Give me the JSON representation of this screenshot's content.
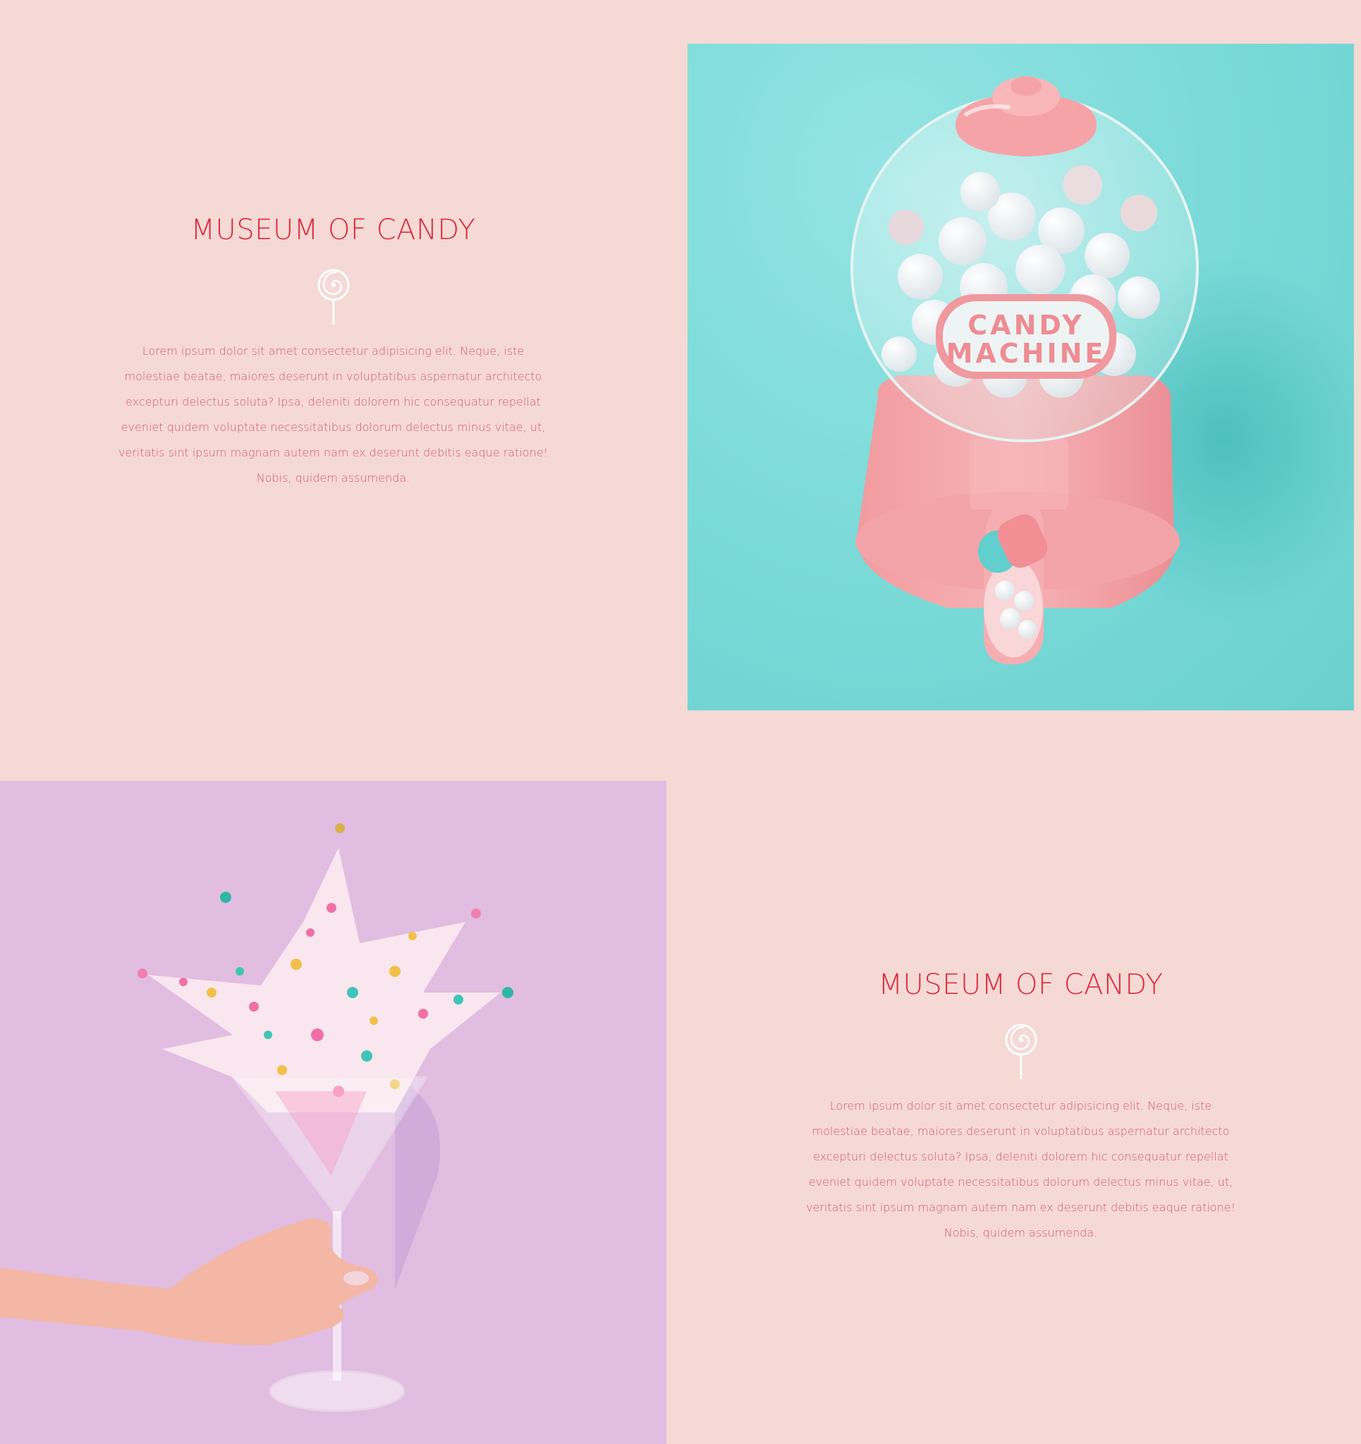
{
  "sections": [
    {
      "heading": "MUSEUM OF CANDY",
      "icon": "lollipop-icon",
      "body": "Lorem ipsum dolor sit amet consectetur adipisicing elit. Neque, iste molestiae beatae, maiores deserunt in voluptatibus aspernatur architecto excepturi delectus soluta? Ipsa, deleniti dolorem hic consequatur repellat eveniet quidem voluptate necessitatibus dolorum delectus minus vitae, ut, veritatis sint ipsum magnam autem nam ex deserunt debitis eaque ratione! Nobis, quidem assumenda."
    },
    {
      "heading": "MUSEUM OF CANDY",
      "icon": "lollipop-icon",
      "body": "Lorem ipsum dolor sit amet consectetur adipisicing elit. Neque, iste molestiae beatae, maiores deserunt in voluptatibus aspernatur architecto excepturi delectus soluta? Ipsa, deleniti dolorem hic consequatur repellat eveniet quidem voluptate necessitatibus dolorum delectus minus vitae, ut, veritatis sint ipsum magnam autem nam ex deserunt debitis eaque ratione! Nobis, quidem assumenda."
    }
  ],
  "photos": {
    "gumball_label_line1": "CANDY",
    "gumball_label_line2": "MACHINE"
  },
  "colors": {
    "background": "#f5d9d5",
    "heading": "#de2a3c",
    "body_text": "#d4577a",
    "teal": "#7fdcda",
    "lavender": "#e1bde1",
    "candy_pink": "#f4a0a4"
  }
}
